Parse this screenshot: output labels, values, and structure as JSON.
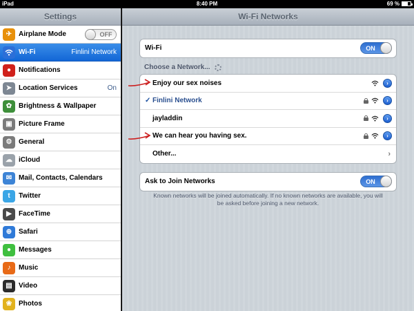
{
  "status_bar": {
    "carrier": "iPad",
    "time": "8:40 PM",
    "battery_text": "69 %",
    "battery_level": 0.69
  },
  "sidebar": {
    "title": "Settings",
    "items": [
      {
        "label": "Airplane Mode",
        "icon": "airplane-icon",
        "icon_color": "#e8900a",
        "toggle_text": "OFF"
      },
      {
        "label": "Wi-Fi",
        "icon": "wifi-icon",
        "icon_color": "#2b6fd8",
        "value": "Finlini Network",
        "selected": true
      },
      {
        "label": "Notifications",
        "icon": "notifications-icon",
        "icon_color": "#d0211b"
      },
      {
        "label": "Location Services",
        "icon": "location-icon",
        "icon_color": "#7d8793",
        "value": "On"
      },
      {
        "label": "Brightness & Wallpaper",
        "icon": "brightness-icon",
        "icon_color": "#3e8f3a"
      },
      {
        "label": "Picture Frame",
        "icon": "picture-frame-icon",
        "icon_color": "#7b7b7b"
      },
      {
        "label": "General",
        "icon": "gear-icon",
        "icon_color": "#7b7b7b"
      },
      {
        "label": "iCloud",
        "icon": "icloud-icon",
        "icon_color": "#9aa2aa"
      },
      {
        "label": "Mail, Contacts, Calendars",
        "icon": "mail-icon",
        "icon_color": "#3d84d6"
      },
      {
        "label": "Twitter",
        "icon": "twitter-icon",
        "icon_color": "#3ba6e6"
      },
      {
        "label": "FaceTime",
        "icon": "facetime-icon",
        "icon_color": "#4a4a4a"
      },
      {
        "label": "Safari",
        "icon": "safari-icon",
        "icon_color": "#2f7ad8"
      },
      {
        "label": "Messages",
        "icon": "messages-icon",
        "icon_color": "#3fbf3f"
      },
      {
        "label": "Music",
        "icon": "music-icon",
        "icon_color": "#e86a17"
      },
      {
        "label": "Video",
        "icon": "video-icon",
        "icon_color": "#2b2b2b"
      },
      {
        "label": "Photos",
        "icon": "photos-icon",
        "icon_color": "#e2b21d"
      }
    ]
  },
  "main": {
    "title": "Wi-Fi Networks",
    "wifi_row": {
      "label": "Wi-Fi",
      "toggle_text": "ON"
    },
    "choose_label": "Choose a Network...",
    "networks": [
      {
        "name": "Enjoy our sex noises",
        "locked": false,
        "selected": false
      },
      {
        "name": "Finlini Network",
        "locked": true,
        "selected": true,
        "check": "✓"
      },
      {
        "name": "jayladdin",
        "locked": true,
        "selected": false
      },
      {
        "name": "We can hear you having sex.",
        "locked": true,
        "selected": false
      }
    ],
    "other_label": "Other...",
    "ask_row": {
      "label": "Ask to Join Networks",
      "toggle_text": "ON"
    },
    "footnote": "Known networks will be joined automatically.  If no known networks are available, you will be asked before joining a new network.",
    "accent_color": "#2f6fd0",
    "annotation_color": "#cc1f1f"
  }
}
